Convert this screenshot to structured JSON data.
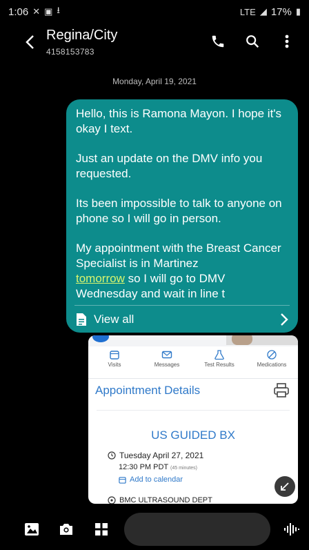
{
  "status_bar": {
    "time": "1:06",
    "network": "LTE",
    "battery": "17%"
  },
  "header": {
    "title": "Regina/City",
    "subtitle": "4158153783"
  },
  "conversation": {
    "date": "Monday, April 19, 2021",
    "message": {
      "p1": "Hello, this is Ramona Mayon. I hope it's okay I text.",
      "p2": "Just an update on the DMV info you requested.",
      "p3": "Its been impossible to talk to anyone on phone so I will go in person.",
      "p4_start": "My appointment with the Breast Cancer Specialist is in Martinez",
      "p4_link": "tomorrow",
      "p4_end": " so I will go to DMV Wednesday and wait in line t",
      "view_all": "View all"
    },
    "attachment": {
      "tabs": [
        "Visits",
        "Messages",
        "Test Results",
        "Medications"
      ],
      "heading": "Appointment Details",
      "title": "US GUIDED BX",
      "date": "Tuesday April 27, 2021",
      "time": "12:30 PM PDT",
      "duration": "(45 minutes)",
      "calendar": "Add to calendar",
      "location": "BMC ULTRASOUND DEPT"
    }
  },
  "colors": {
    "bubble": "#0d8c8c",
    "link": "#d8f56e",
    "accent": "#2f79c9"
  }
}
